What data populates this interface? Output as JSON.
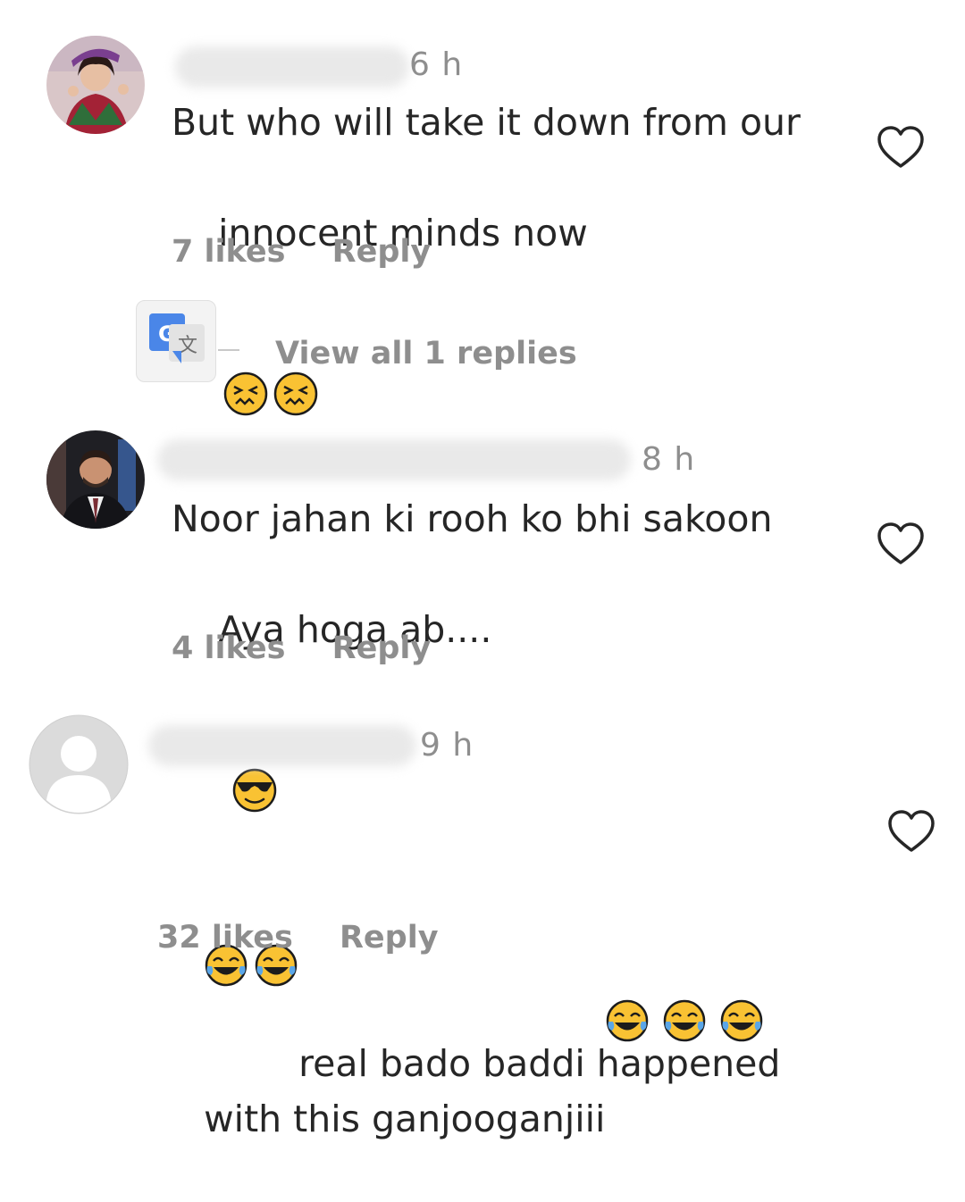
{
  "comments": [
    {
      "time": "6 h",
      "text_line1": "But who will take it down from our",
      "text_line2": "innocent minds now",
      "likes": "7 likes",
      "reply": "Reply",
      "emoji": [
        "tired-face",
        "tired-face"
      ]
    },
    {
      "time": "8 h",
      "text_line1": "Noor jahan ki rooh ko bhi sakoon",
      "text_line2": "Aya hoga ab....",
      "likes": "4 likes",
      "reply": "Reply",
      "emoji": [
        "sunglasses-face"
      ]
    },
    {
      "time": "9 h",
      "text_line1": "real bado baddi happened",
      "text_line2": "with this ganjooganjiii",
      "likes": "32 likes",
      "reply": "Reply",
      "emoji": [
        "tears-of-joy",
        "tears-of-joy",
        "tears-of-joy",
        "tears-of-joy",
        "tears-of-joy"
      ]
    }
  ],
  "replies_link": "View all 1 replies",
  "icons": {
    "like": "heart-outline-icon",
    "translate": "google-translate-icon"
  },
  "colors": {
    "text": "#262626",
    "muted": "#8e8e8e",
    "emoji_yellow": "#f9c233"
  }
}
